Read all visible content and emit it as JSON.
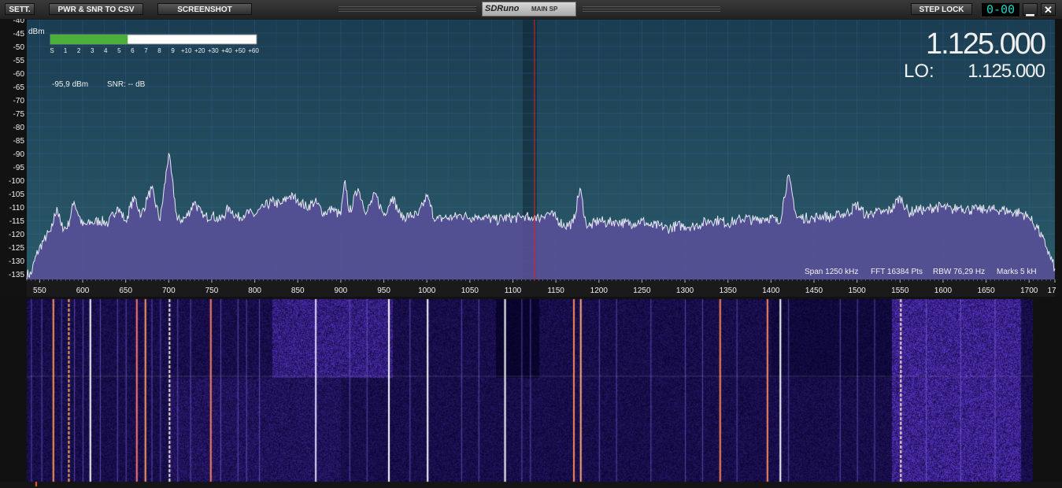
{
  "toolbar": {
    "sett_label": "SETT.",
    "csv_label": "PWR & SNR TO CSV",
    "screenshot_label": "SCREENSHOT",
    "app_logo": "SDRuno",
    "panel_name": "MAIN SP",
    "step_lock_label": "STEP LOCK",
    "step_value": "0-00",
    "minimize_glyph": "▁",
    "close_glyph": "✕"
  },
  "spectrum": {
    "dbm_unit": "dBm",
    "y_ticks": [
      "-40",
      "-45",
      "-50",
      "-55",
      "-60",
      "-65",
      "-70",
      "-75",
      "-80",
      "-85",
      "-90",
      "-95",
      "-100",
      "-105",
      "-110",
      "-115",
      "-120",
      "-125",
      "-130",
      "-135"
    ],
    "x_ticks": [
      "550",
      "600",
      "650",
      "700",
      "750",
      "800",
      "850",
      "900",
      "950",
      "1000",
      "1050",
      "1100",
      "1150",
      "1200",
      "1250",
      "1300",
      "1350",
      "1400",
      "1450",
      "1500",
      "1550",
      "1600",
      "1650",
      "1700",
      "17"
    ],
    "smeter_labels": [
      "S",
      "1",
      "2",
      "3",
      "4",
      "5",
      "6",
      "7",
      "8",
      "9",
      "+10",
      "+20",
      "+30",
      "+40",
      "+50",
      "+60"
    ],
    "smeter_level": 0.375,
    "power_readout": "-95,9 dBm",
    "snr_readout": "SNR: -- dB",
    "frequency": "1.125.000",
    "lo_label": "LO:",
    "lo_frequency": "1.125.000",
    "info_span": "Span 1250 kHz",
    "info_fft": "FFT 16384 Pts",
    "info_rbw": "RBW 76,29 Hz",
    "info_marks": "Marks 5 kH",
    "colors": {
      "background": "#1c4556",
      "grid": "#3f5f9a",
      "fill": "#5a4f9a",
      "trace": "#e8e8f4",
      "cursor": "#e02020"
    }
  },
  "chart_data": {
    "type": "area",
    "x": [
      540,
      546,
      555,
      563,
      570,
      575,
      582,
      590,
      600,
      610,
      620,
      630,
      640,
      650,
      660,
      668,
      675,
      680,
      690,
      700,
      710,
      720,
      730,
      740,
      750,
      760,
      770,
      780,
      790,
      800,
      810,
      820,
      830,
      840,
      850,
      860,
      870,
      880,
      890,
      900,
      905,
      910,
      920,
      930,
      940,
      950,
      960,
      970,
      980,
      990,
      1000,
      1010,
      1020,
      1030,
      1040,
      1050,
      1060,
      1070,
      1080,
      1090,
      1100,
      1110,
      1115,
      1120,
      1125,
      1130,
      1140,
      1150,
      1160,
      1170,
      1178,
      1185,
      1190,
      1200,
      1210,
      1220,
      1230,
      1240,
      1250,
      1260,
      1270,
      1280,
      1290,
      1300,
      1310,
      1320,
      1330,
      1340,
      1350,
      1360,
      1370,
      1380,
      1390,
      1400,
      1410,
      1420,
      1430,
      1440,
      1450,
      1460,
      1470,
      1480,
      1490,
      1500,
      1510,
      1520,
      1530,
      1540,
      1550,
      1560,
      1570,
      1580,
      1590,
      1600,
      1610,
      1620,
      1630,
      1640,
      1650,
      1660,
      1670,
      1680,
      1690,
      1700,
      1710,
      1720,
      1730
    ],
    "y": [
      -135,
      -128,
      -122,
      -119,
      -110,
      -117,
      -118,
      -108,
      -117,
      -116,
      -115,
      -116,
      -110,
      -115,
      -106,
      -113,
      -107,
      -103,
      -115,
      -90,
      -115,
      -114,
      -108,
      -114,
      -113,
      -115,
      -110,
      -114,
      -112,
      -113,
      -110,
      -108,
      -109,
      -106,
      -107,
      -110,
      -108,
      -112,
      -111,
      -113,
      -100,
      -112,
      -103,
      -112,
      -105,
      -113,
      -106,
      -114,
      -113,
      -113,
      -106,
      -115,
      -114,
      -114,
      -113,
      -114,
      -113,
      -114,
      -115,
      -114,
      -114,
      -114,
      -113,
      -115,
      -113,
      -114,
      -112,
      -114,
      -117,
      -116,
      -103,
      -116,
      -117,
      -115,
      -116,
      -115,
      -116,
      -116,
      -115,
      -117,
      -117,
      -118,
      -117,
      -117,
      -117,
      -116,
      -115,
      -115,
      -116,
      -115,
      -114,
      -115,
      -114,
      -114,
      -116,
      -98,
      -114,
      -114,
      -114,
      -113,
      -114,
      -113,
      -112,
      -109,
      -113,
      -112,
      -112,
      -111,
      -106,
      -112,
      -111,
      -111,
      -110,
      -110,
      -111,
      -110,
      -111,
      -111,
      -111,
      -111,
      -111,
      -112,
      -112,
      -114,
      -118,
      -125,
      -133,
      -137
    ],
    "xlabel": "",
    "ylabel": "dBm",
    "xlim": [
      535,
      1730
    ],
    "ylim": [
      -137,
      -40
    ],
    "grid": true,
    "marker_x": 1125
  },
  "waterfall": {
    "colors": {
      "background": "#0a0a55",
      "bright": "#9c6cff",
      "line_hot": "#ffb25a",
      "line_white": "#ffffff"
    }
  }
}
